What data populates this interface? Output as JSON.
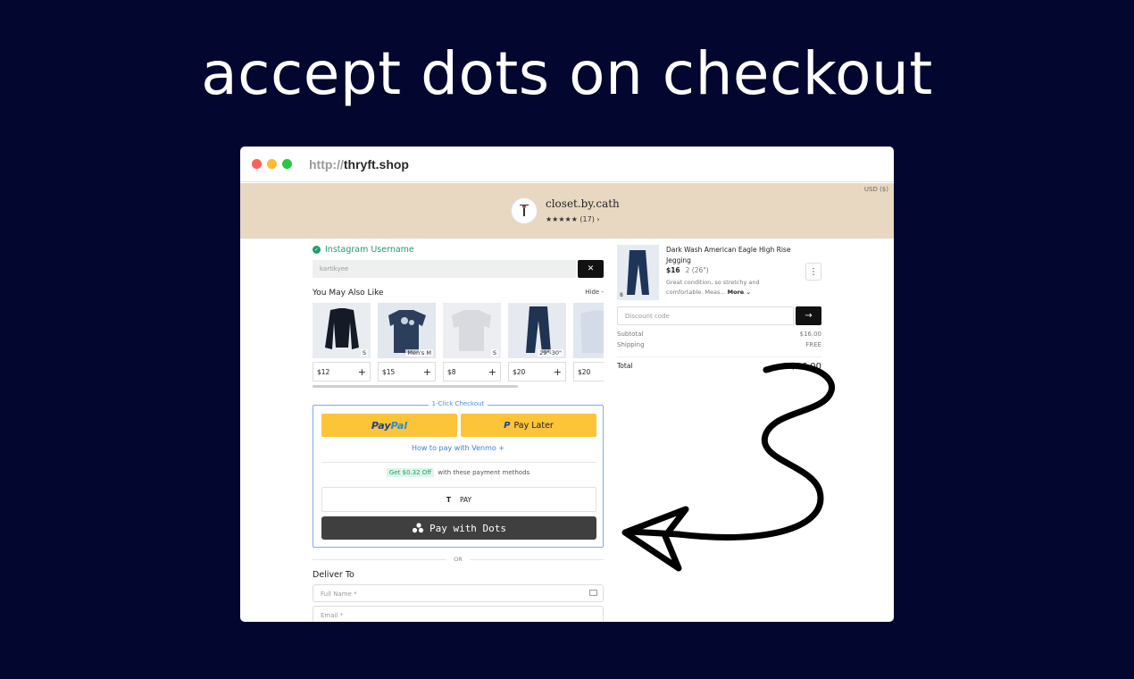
{
  "headline": "accept dots on checkout",
  "browser": {
    "url_protocol": "http://",
    "url_host": "thryft.shop"
  },
  "shop": {
    "currency": "USD ($)",
    "name": "closet.by.cath",
    "rating": "★★★★★ (17) ›"
  },
  "instagram": {
    "label": "Instagram Username",
    "value": "kartikyee",
    "clear_icon": "✕"
  },
  "also_like": {
    "heading": "You May Also Like",
    "hide_label": "Hide -",
    "items": [
      {
        "tag": "S",
        "price": "$12",
        "plus": "+"
      },
      {
        "tag": "Men's M",
        "price": "$15",
        "plus": "+"
      },
      {
        "tag": "S",
        "price": "$8",
        "plus": "+"
      },
      {
        "tag": "29\"-30\"",
        "price": "$20",
        "plus": "+"
      },
      {
        "tag": "",
        "price": "$20",
        "plus": ""
      }
    ]
  },
  "checkout": {
    "legend": "1-Click Checkout",
    "paypal_pay": "Pay",
    "paypal_pal": "Pal",
    "paylater_icon": "P",
    "paylater_label": "Pay Later",
    "venmo_link": "How to pay with Venmo +",
    "discount_badge": "Get $0.32 Off",
    "discount_text": "with these payment methods",
    "tpay_logo": "T",
    "tpay_label": "PAY",
    "dots_label": "Pay with Dots"
  },
  "or_label": "OR",
  "deliver": {
    "heading": "Deliver To",
    "full_name_placeholder": "Full Name *",
    "email_placeholder": "Email *"
  },
  "cart": {
    "item_title": "Dark Wash American Eagle High Rise Jegging",
    "item_price": "$16",
    "item_size": "2 (26\")",
    "item_desc": "Great condition, so stretchy and comfortable. Meas...",
    "more_label": "More ⌄",
    "qty_badge": "8",
    "discount_placeholder": "Discount code",
    "discount_go": "→",
    "subtotal_label": "Subtotal",
    "subtotal_value": "$16.00",
    "shipping_label": "Shipping",
    "shipping_value": "FREE",
    "total_label": "Total",
    "total_value": "$16.00"
  },
  "colors": {
    "background": "#03062e",
    "banner": "#e8d8c2",
    "paypal_yellow": "#fcc439",
    "dots_button": "#3f3f3f",
    "accent_green": "#1f9d6a",
    "link_blue": "#3b7fd4"
  },
  "icons": [
    "check-circle-icon",
    "close-icon",
    "plus-icon",
    "paypal-logo",
    "dots-logo",
    "arrow-right-icon",
    "kebab-icon",
    "card-icon"
  ]
}
